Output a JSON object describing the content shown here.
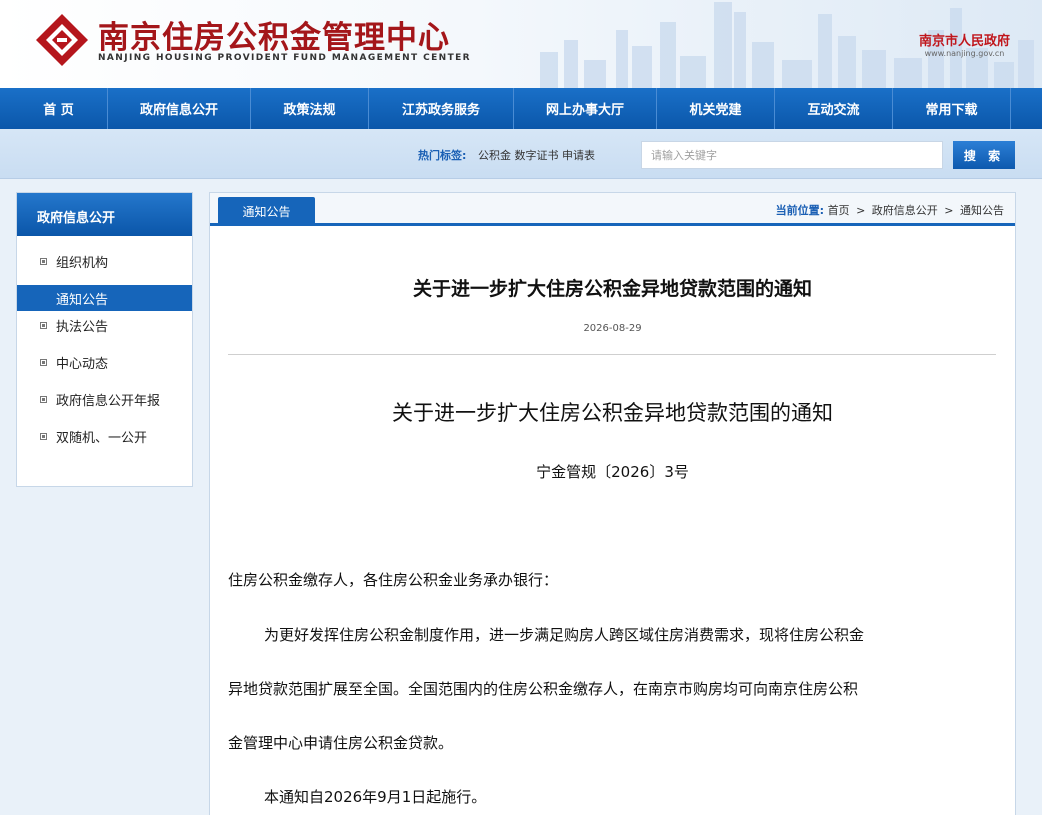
{
  "header": {
    "site_title": "南京住房公积金管理中心",
    "site_subtitle": "NANJING HOUSING PROVIDENT FUND MANAGEMENT CENTER",
    "gov_name": "南京市人民政府",
    "gov_url": "www.nanjing.gov.cn"
  },
  "nav": {
    "items": [
      {
        "label": "首 页"
      },
      {
        "label": "政府信息公开"
      },
      {
        "label": "政策法规"
      },
      {
        "label": "江苏政务服务"
      },
      {
        "label": "网上办事大厅"
      },
      {
        "label": "机关党建"
      },
      {
        "label": "互动交流"
      },
      {
        "label": "常用下载"
      }
    ]
  },
  "search": {
    "hot_label": "热门标签:",
    "hot_tags": "公积金  数字证书  申请表",
    "placeholder": "请输入关键字",
    "button_label": "搜 索"
  },
  "sidebar": {
    "title": "政府信息公开",
    "items": [
      {
        "label": "组织机构"
      },
      {
        "label": "通知公告"
      },
      {
        "label": "执法公告"
      },
      {
        "label": "中心动态"
      },
      {
        "label": "政府信息公开年报"
      },
      {
        "label": "双随机、一公开"
      }
    ]
  },
  "main": {
    "tab_label": "通知公告",
    "breadcrumb": {
      "label": "当前位置:",
      "items": [
        "首页",
        "政府信息公开",
        "通知公告"
      ],
      "separator": ">"
    },
    "article": {
      "title": "关于进一步扩大住房公积金异地贷款范围的通知",
      "date": "2026-08-29",
      "doc_title": "关于进一步扩大住房公积金异地贷款范围的通知",
      "doc_number": "宁金管规〔2026〕3号",
      "salutation": "住房公积金缴存人，各住房公积金业务承办银行：",
      "body_lines": [
        "为更好发挥住房公积金制度作用，进一步满足购房人跨区域住房消费需求，现将住房公积金",
        "异地贷款范围扩展至全国。全国范围内的住房公积金缴存人，在南京市购房均可向南京住房公积",
        "金管理中心申请住房公积金贷款。"
      ],
      "effective": "本通知自2026年9月1日起施行。"
    }
  },
  "colors": {
    "primary_blue": "#1665ba",
    "brand_red": "#a4161a",
    "gov_red": "#c0161c"
  }
}
